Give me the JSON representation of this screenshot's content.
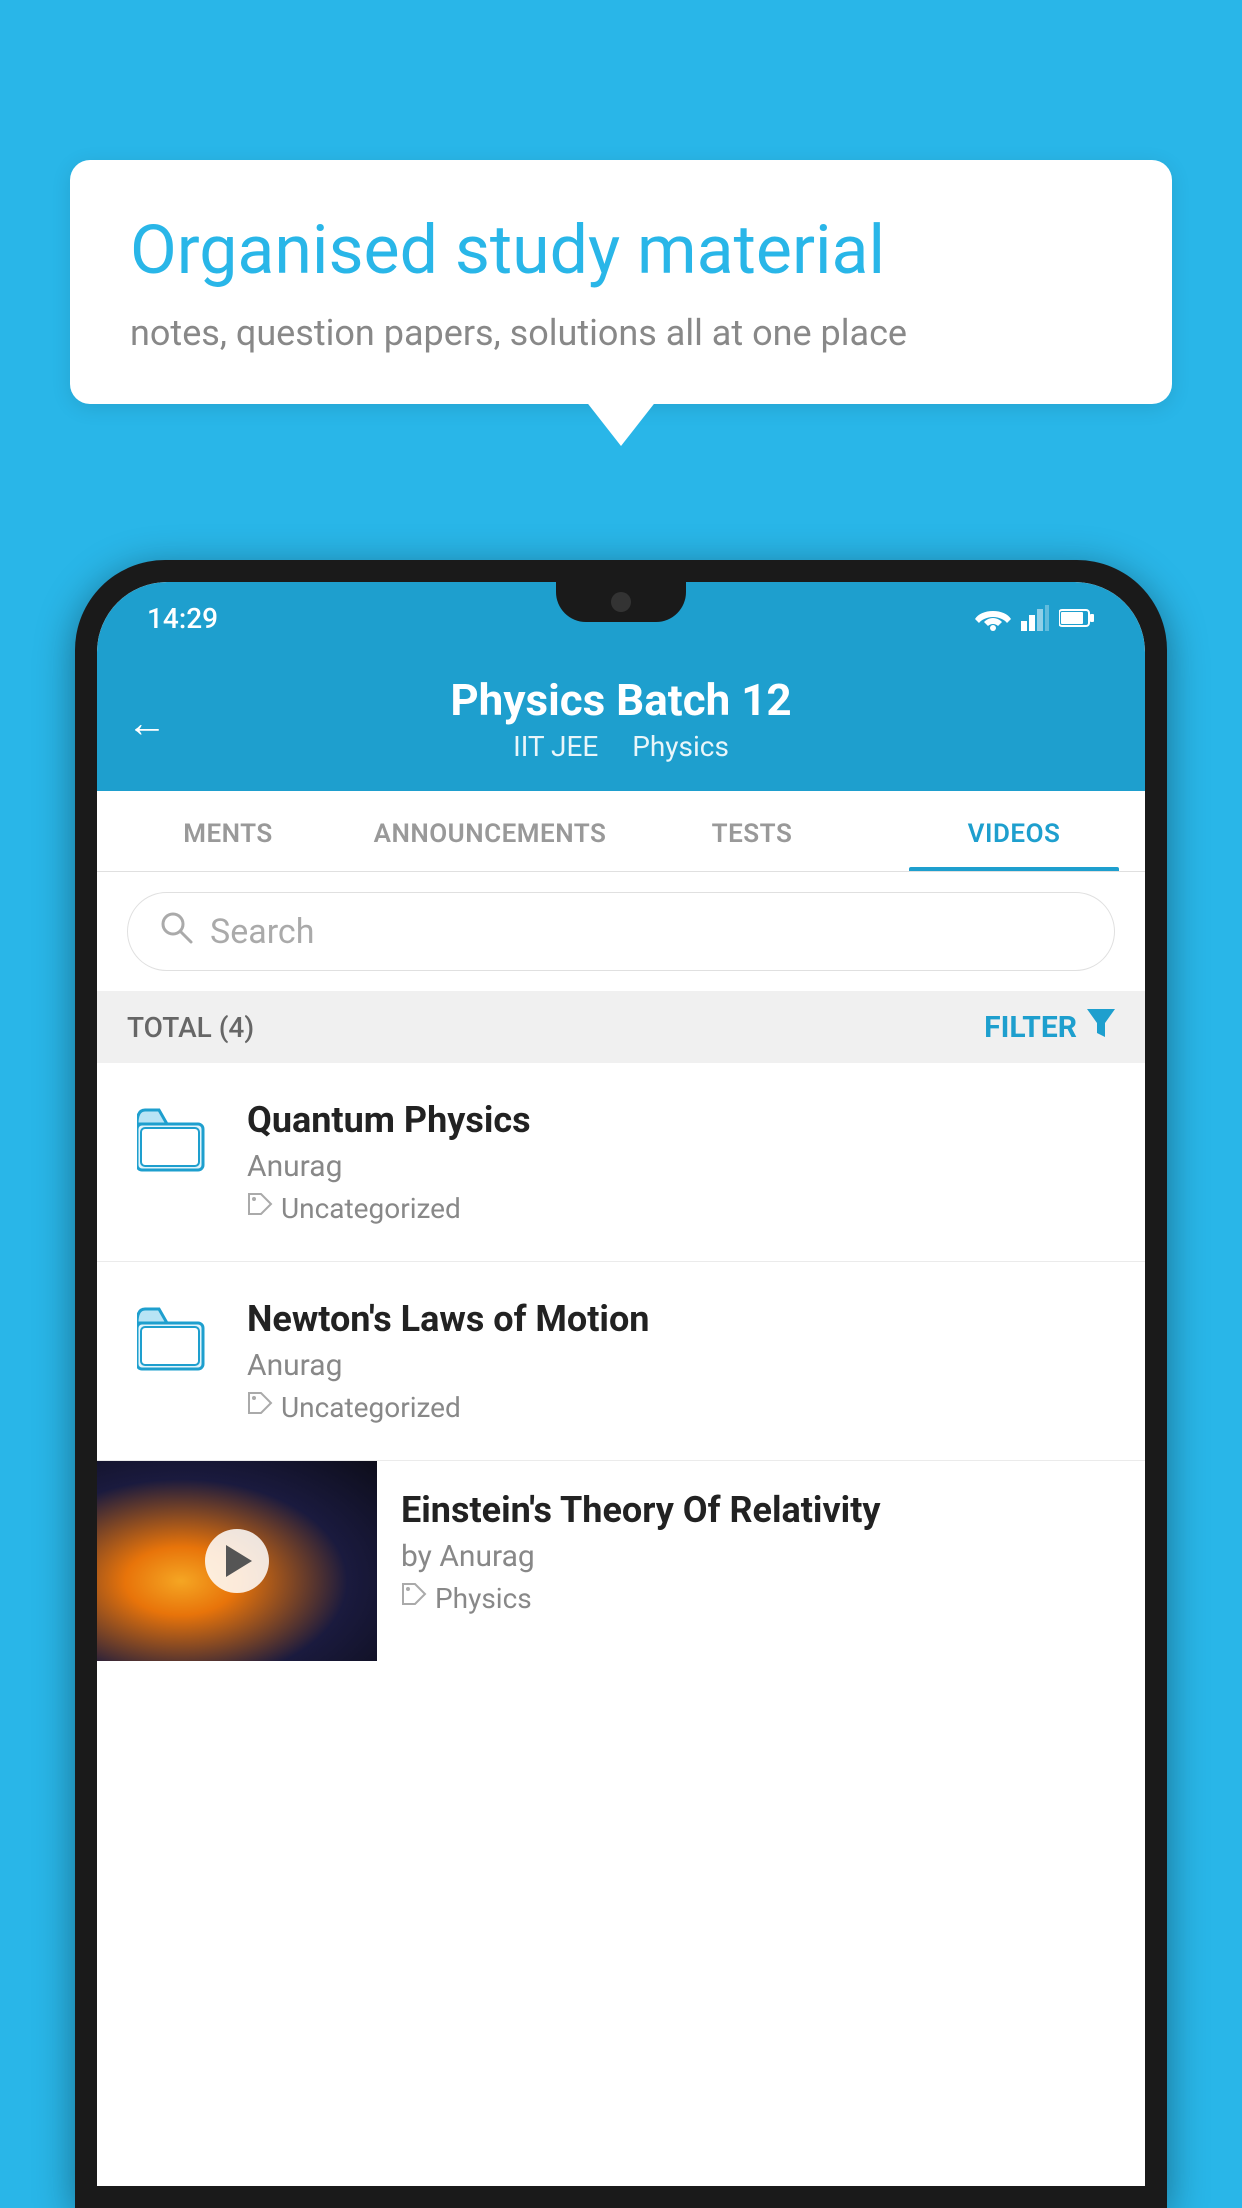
{
  "background_color": "#29b6e8",
  "speech_bubble": {
    "title": "Organised study material",
    "subtitle": "notes, question papers, solutions all at one place"
  },
  "phone": {
    "status_bar": {
      "time": "14:29"
    },
    "header": {
      "back_label": "←",
      "title": "Physics Batch 12",
      "subtitle_left": "IIT JEE",
      "subtitle_right": "Physics"
    },
    "tabs": [
      {
        "label": "MENTS",
        "active": false
      },
      {
        "label": "ANNOUNCEMENTS",
        "active": false
      },
      {
        "label": "TESTS",
        "active": false
      },
      {
        "label": "VIDEOS",
        "active": true
      }
    ],
    "search": {
      "placeholder": "Search"
    },
    "filter_bar": {
      "total_label": "TOTAL (4)",
      "filter_label": "FILTER"
    },
    "videos": [
      {
        "id": 1,
        "title": "Quantum Physics",
        "author": "Anurag",
        "tag": "Uncategorized",
        "has_thumbnail": false
      },
      {
        "id": 2,
        "title": "Newton's Laws of Motion",
        "author": "Anurag",
        "tag": "Uncategorized",
        "has_thumbnail": false
      },
      {
        "id": 3,
        "title": "Einstein's Theory Of Relativity",
        "author": "by Anurag",
        "tag": "Physics",
        "has_thumbnail": true
      }
    ]
  }
}
